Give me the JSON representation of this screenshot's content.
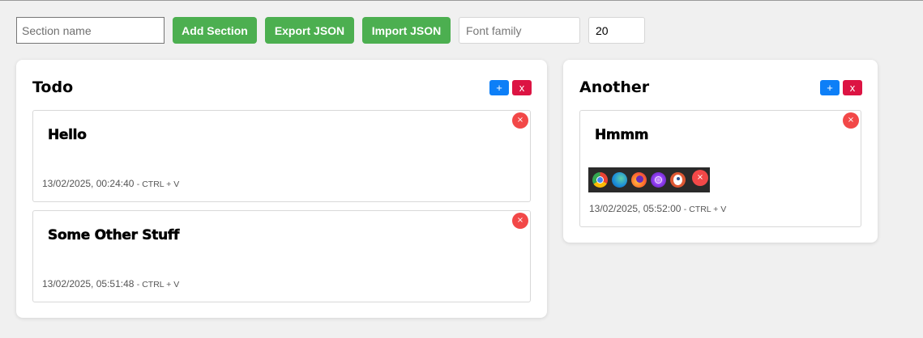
{
  "toolbar": {
    "section_name_placeholder": "Section name",
    "add_section_label": "Add Section",
    "export_label": "Export JSON",
    "import_label": "Import JSON",
    "font_family_placeholder": "Font family",
    "font_size_value": "20"
  },
  "sections": [
    {
      "title": "Todo",
      "add_label": "+",
      "delete_label": "x",
      "cards": [
        {
          "title": "Hello",
          "date": "13/02/2025, 00:24:40",
          "hint": "- CTRL + V",
          "delete_label": "×"
        },
        {
          "title": "Some Other Stuff",
          "date": "13/02/2025, 05:51:48",
          "hint": "- CTRL + V",
          "delete_label": "×"
        }
      ]
    },
    {
      "title": "Another",
      "add_label": "+",
      "delete_label": "x",
      "cards": [
        {
          "title": "Hmmm",
          "date": "13/02/2025, 05:52:00",
          "hint": "- CTRL + V",
          "delete_label": "×",
          "image": {
            "icons": [
              "chrome-icon",
              "edge-icon",
              "firefox-icon",
              "tor-browser-icon",
              "duckduckgo-icon"
            ],
            "delete_label": "×"
          }
        }
      ]
    }
  ],
  "colors": {
    "green_button": "#4caf50",
    "add_blue": "#0d7ff7",
    "delete_red": "#dc1443",
    "card_delete_red": "#f24848",
    "background": "#f0f0f0"
  }
}
